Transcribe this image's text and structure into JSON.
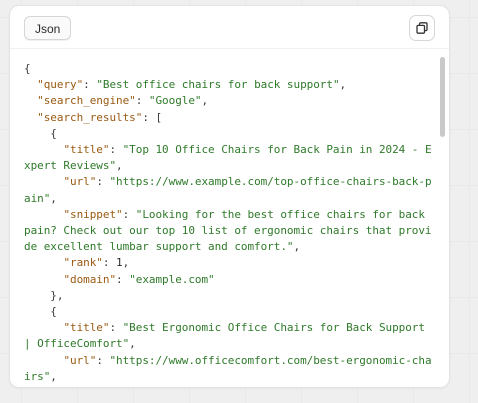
{
  "tab": {
    "label": "Json"
  },
  "icons": {
    "copy": "copy-icon"
  },
  "colors": {
    "key": "#9a5a12",
    "string": "#2f7a2a",
    "punct": "#3c3c3c"
  },
  "code": [
    {
      "p": "{"
    },
    {
      "p": "  ",
      "k": "\"query\"",
      "sep": ": ",
      "s": "\"Best office chairs for back support\"",
      "end": ","
    },
    {
      "p": "  ",
      "k": "\"search_engine\"",
      "sep": ": ",
      "s": "\"Google\"",
      "end": ","
    },
    {
      "p": "  ",
      "k": "\"search_results\"",
      "sep": ": [",
      "s": "",
      "end": ""
    },
    {
      "p": "    {"
    },
    {
      "p": "      ",
      "k": "\"title\"",
      "sep": ": ",
      "s": "\"Top 10 Office Chairs for Back Pain in 2024 - E",
      "end": ""
    },
    {
      "p": "",
      "k": "",
      "sep": "",
      "s": "xpert Reviews\"",
      "end": ","
    },
    {
      "p": "      ",
      "k": "\"url\"",
      "sep": ": ",
      "s": "\"https://www.example.com/top-office-chairs-back-p",
      "end": ""
    },
    {
      "p": "",
      "k": "",
      "sep": "",
      "s": "ain\"",
      "end": ","
    },
    {
      "p": "      ",
      "k": "\"snippet\"",
      "sep": ": ",
      "s": "\"Looking for the best office chairs for back",
      "end": ""
    },
    {
      "p": "",
      "k": "",
      "sep": "",
      "s": "pain? Check out our top 10 list of ergonomic chairs that provi",
      "end": ""
    },
    {
      "p": "",
      "k": "",
      "sep": "",
      "s": "de excellent lumbar support and comfort.\"",
      "end": ","
    },
    {
      "p": "      ",
      "k": "\"rank\"",
      "sep": ": ",
      "n": "1",
      "end": ","
    },
    {
      "p": "      ",
      "k": "\"domain\"",
      "sep": ": ",
      "s": "\"example.com\"",
      "end": ""
    },
    {
      "p": "    },"
    },
    {
      "p": "    {"
    },
    {
      "p": "      ",
      "k": "\"title\"",
      "sep": ": ",
      "s": "\"Best Ergonomic Office Chairs for Back Support",
      "end": ""
    },
    {
      "p": "",
      "k": "",
      "sep": "",
      "s": "| OfficeComfort\"",
      "end": ","
    },
    {
      "p": "      ",
      "k": "\"url\"",
      "sep": ": ",
      "s": "\"https://www.officecomfort.com/best-ergonomic-cha",
      "end": ""
    },
    {
      "p": "",
      "k": "",
      "sep": "",
      "s": "irs\"",
      "end": ","
    }
  ]
}
